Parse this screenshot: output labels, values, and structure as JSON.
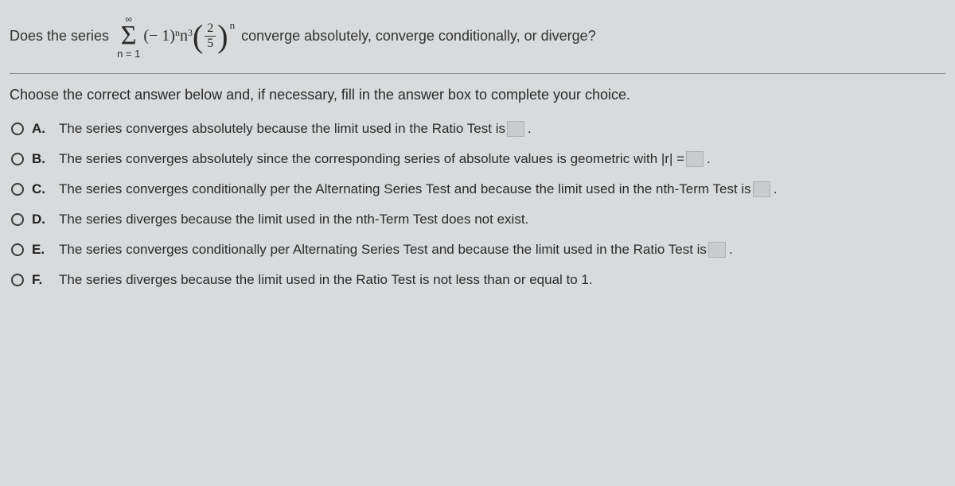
{
  "question": {
    "lead": "Does the series",
    "sigma_top": "∞",
    "sigma_bot": "n = 1",
    "term_prefix": "(− 1)",
    "term_exp1": "n",
    "term_var": "n",
    "term_exp2": "3",
    "frac_num": "2",
    "frac_den": "5",
    "outer_exp": "n",
    "tail": "converge absolutely, converge conditionally, or diverge?"
  },
  "instruction": "Choose the correct answer below and, if necessary, fill in the answer box to complete your choice.",
  "options": {
    "a": {
      "label": "A.",
      "text_before": "The series converges absolutely because the limit used in the Ratio Test is ",
      "has_box": true,
      "text_after": "."
    },
    "b": {
      "label": "B.",
      "text_before": "The series converges absolutely since the corresponding series of absolute values is geometric with |r| = ",
      "has_box": true,
      "text_after": "."
    },
    "c": {
      "label": "C.",
      "text_before": "The series converges conditionally per the Alternating Series Test and because the limit used in the nth-Term Test is ",
      "has_box": true,
      "text_after": "."
    },
    "d": {
      "label": "D.",
      "text_before": "The series diverges because the limit used in the nth-Term Test does not exist.",
      "has_box": false,
      "text_after": ""
    },
    "e": {
      "label": "E.",
      "text_before": "The series converges conditionally per Alternating Series Test and because the limit used in the Ratio Test is ",
      "has_box": true,
      "text_after": "."
    },
    "f": {
      "label": "F.",
      "text_before": "The series diverges because the limit used in the Ratio Test is not less than or equal to 1.",
      "has_box": false,
      "text_after": ""
    }
  }
}
